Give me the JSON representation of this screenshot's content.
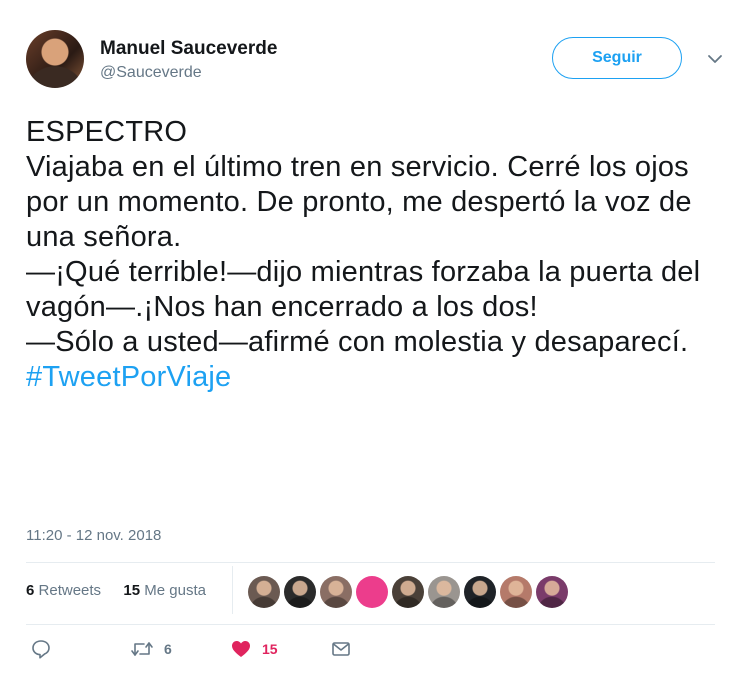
{
  "author": {
    "name": "Manuel Sauceverde",
    "handle": "@Sauceverde"
  },
  "follow_label": "Seguir",
  "tweet": {
    "lines": [
      "ESPECTRO",
      "Viajaba en el último tren en servicio. Cerré los ojos por un momento. De pronto, me despertó la voz de una señora.",
      "—¡Qué terrible!—dijo mientras forzaba la puerta del vagón—.¡Nos han encerrado a los dos!",
      "—Sólo a usted—afirmé con molestia y desaparecí."
    ],
    "hashtag": "#TweetPorViaje"
  },
  "timestamp": "11:20 - 12 nov. 2018",
  "stats": {
    "retweets_count": "6",
    "retweets_label": "Retweets",
    "likes_count": "15",
    "likes_label": "Me gusta"
  },
  "likers": [
    {
      "icon": "avatar",
      "color": "#6b5a52"
    },
    {
      "icon": "avatar",
      "color": "#2b2b2b"
    },
    {
      "icon": "avatar",
      "color": "#8a6e64"
    },
    {
      "icon": "cultura-logo",
      "color": "#ec3d8c"
    },
    {
      "icon": "avatar",
      "color": "#4a4038"
    },
    {
      "icon": "avatar",
      "color": "#9a9590"
    },
    {
      "icon": "avatar",
      "color": "#1f2328"
    },
    {
      "icon": "avatar",
      "color": "#b57a6a"
    },
    {
      "icon": "avatar",
      "color": "#7a3b6a"
    }
  ],
  "actions": {
    "reply_count": "",
    "retweet_count": "6",
    "like_count": "15"
  },
  "colors": {
    "accent": "#1da1f2",
    "like": "#e0245e",
    "muted": "#657786"
  }
}
